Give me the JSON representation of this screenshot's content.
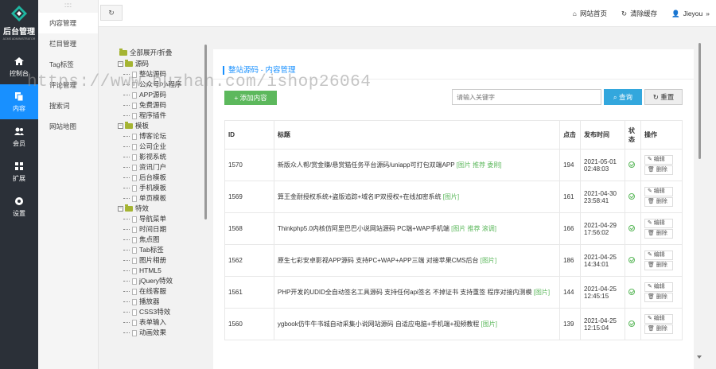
{
  "brand": {
    "title": "后台管理",
    "subtitle": "ACMS ADMINISTRATOR"
  },
  "rail": [
    {
      "label": "控制台",
      "icon": "home-icon",
      "active": false
    },
    {
      "label": "内容",
      "icon": "copy-icon",
      "active": true
    },
    {
      "label": "会员",
      "icon": "users-icon",
      "active": false
    },
    {
      "label": "扩展",
      "icon": "puzzle-icon",
      "active": false
    },
    {
      "label": "设置",
      "icon": "gear-icon",
      "active": false
    }
  ],
  "subnav": [
    "内容管理",
    "栏目管理",
    "Tag标签",
    "评论管理",
    "搜索词",
    "网站地图"
  ],
  "topbar": {
    "refresh": "↻",
    "home": "网站首页",
    "clear": "清除缓存",
    "user": "Jieyou"
  },
  "tree": {
    "toggle": "全部展开/折叠",
    "groups": [
      {
        "label": "源码",
        "children": [
          "整站源码",
          "公众号/小程序",
          "APP源码",
          "免费源码",
          "程序插件"
        ]
      },
      {
        "label": "模板",
        "children": [
          "博客论坛",
          "公司企业",
          "影视系统",
          "资讯门户",
          "后台模板",
          "手机模板",
          "单页模板"
        ]
      },
      {
        "label": "特效",
        "children": [
          "导航菜单",
          "时间日期",
          "焦点图",
          "Tab标签",
          "图片相册",
          "HTML5",
          "jQuery特效",
          "在线客服",
          "播放器",
          "CSS3特效",
          "表单输入",
          "动画效果"
        ]
      }
    ]
  },
  "main": {
    "crumb": "整站源码 - 内容管理",
    "add_label": "+ 添加内容",
    "search_placeholder": "请输入关键字",
    "query_label": "查询",
    "reset_label": "重置",
    "columns": [
      "ID",
      "标题",
      "点击",
      "发布时间",
      "状态",
      "操作"
    ],
    "edit_label": "编辑",
    "delete_label": "删除",
    "rows": [
      {
        "id": "1570",
        "title": "新版众人帮/赏金赚/悬赏猫任务平台源码/uniapp可打包双端APP",
        "tags": "[图片 推荐 委刚]",
        "clicks": "194",
        "date": "2021-05-01",
        "time": "02:48:03"
      },
      {
        "id": "1569",
        "title": "算王金耐授权系统+盗版追踪+域名IP双授权+在线加密系统",
        "tags": "[图片]",
        "clicks": "161",
        "date": "2021-04-30",
        "time": "23:58:41"
      },
      {
        "id": "1568",
        "title": "Thinkphp5.0内核仿阿里巴巴小说网站源码 PC端+WAP手机端",
        "tags": "[图片 推荐 滚调]",
        "clicks": "166",
        "date": "2021-04-29",
        "time": "17:56:02"
      },
      {
        "id": "1562",
        "title": "原生七彩安卓影视APP源码 支持PC+WAP+APP三端 对接苹果CMS后台",
        "tags": "[图片]",
        "clicks": "186",
        "date": "2021-04-25",
        "time": "14:34:01"
      },
      {
        "id": "1561",
        "title": "PHP开发的UDID全自动签名工具源码 支持任何api签名 不掉证书 支持重签 程序对接内测模",
        "tags": "[图片]",
        "clicks": "144",
        "date": "2021-04-25",
        "time": "12:45:15"
      },
      {
        "id": "1560",
        "title": "ygbook仿牛牛书城自动采集小说网站源码 自适应电脑+手机端+视频教程",
        "tags": "[图片]",
        "clicks": "139",
        "date": "2021-04-25",
        "time": "12:15:04"
      }
    ]
  },
  "watermark": "https://www.huzhan.com/ishop26064"
}
